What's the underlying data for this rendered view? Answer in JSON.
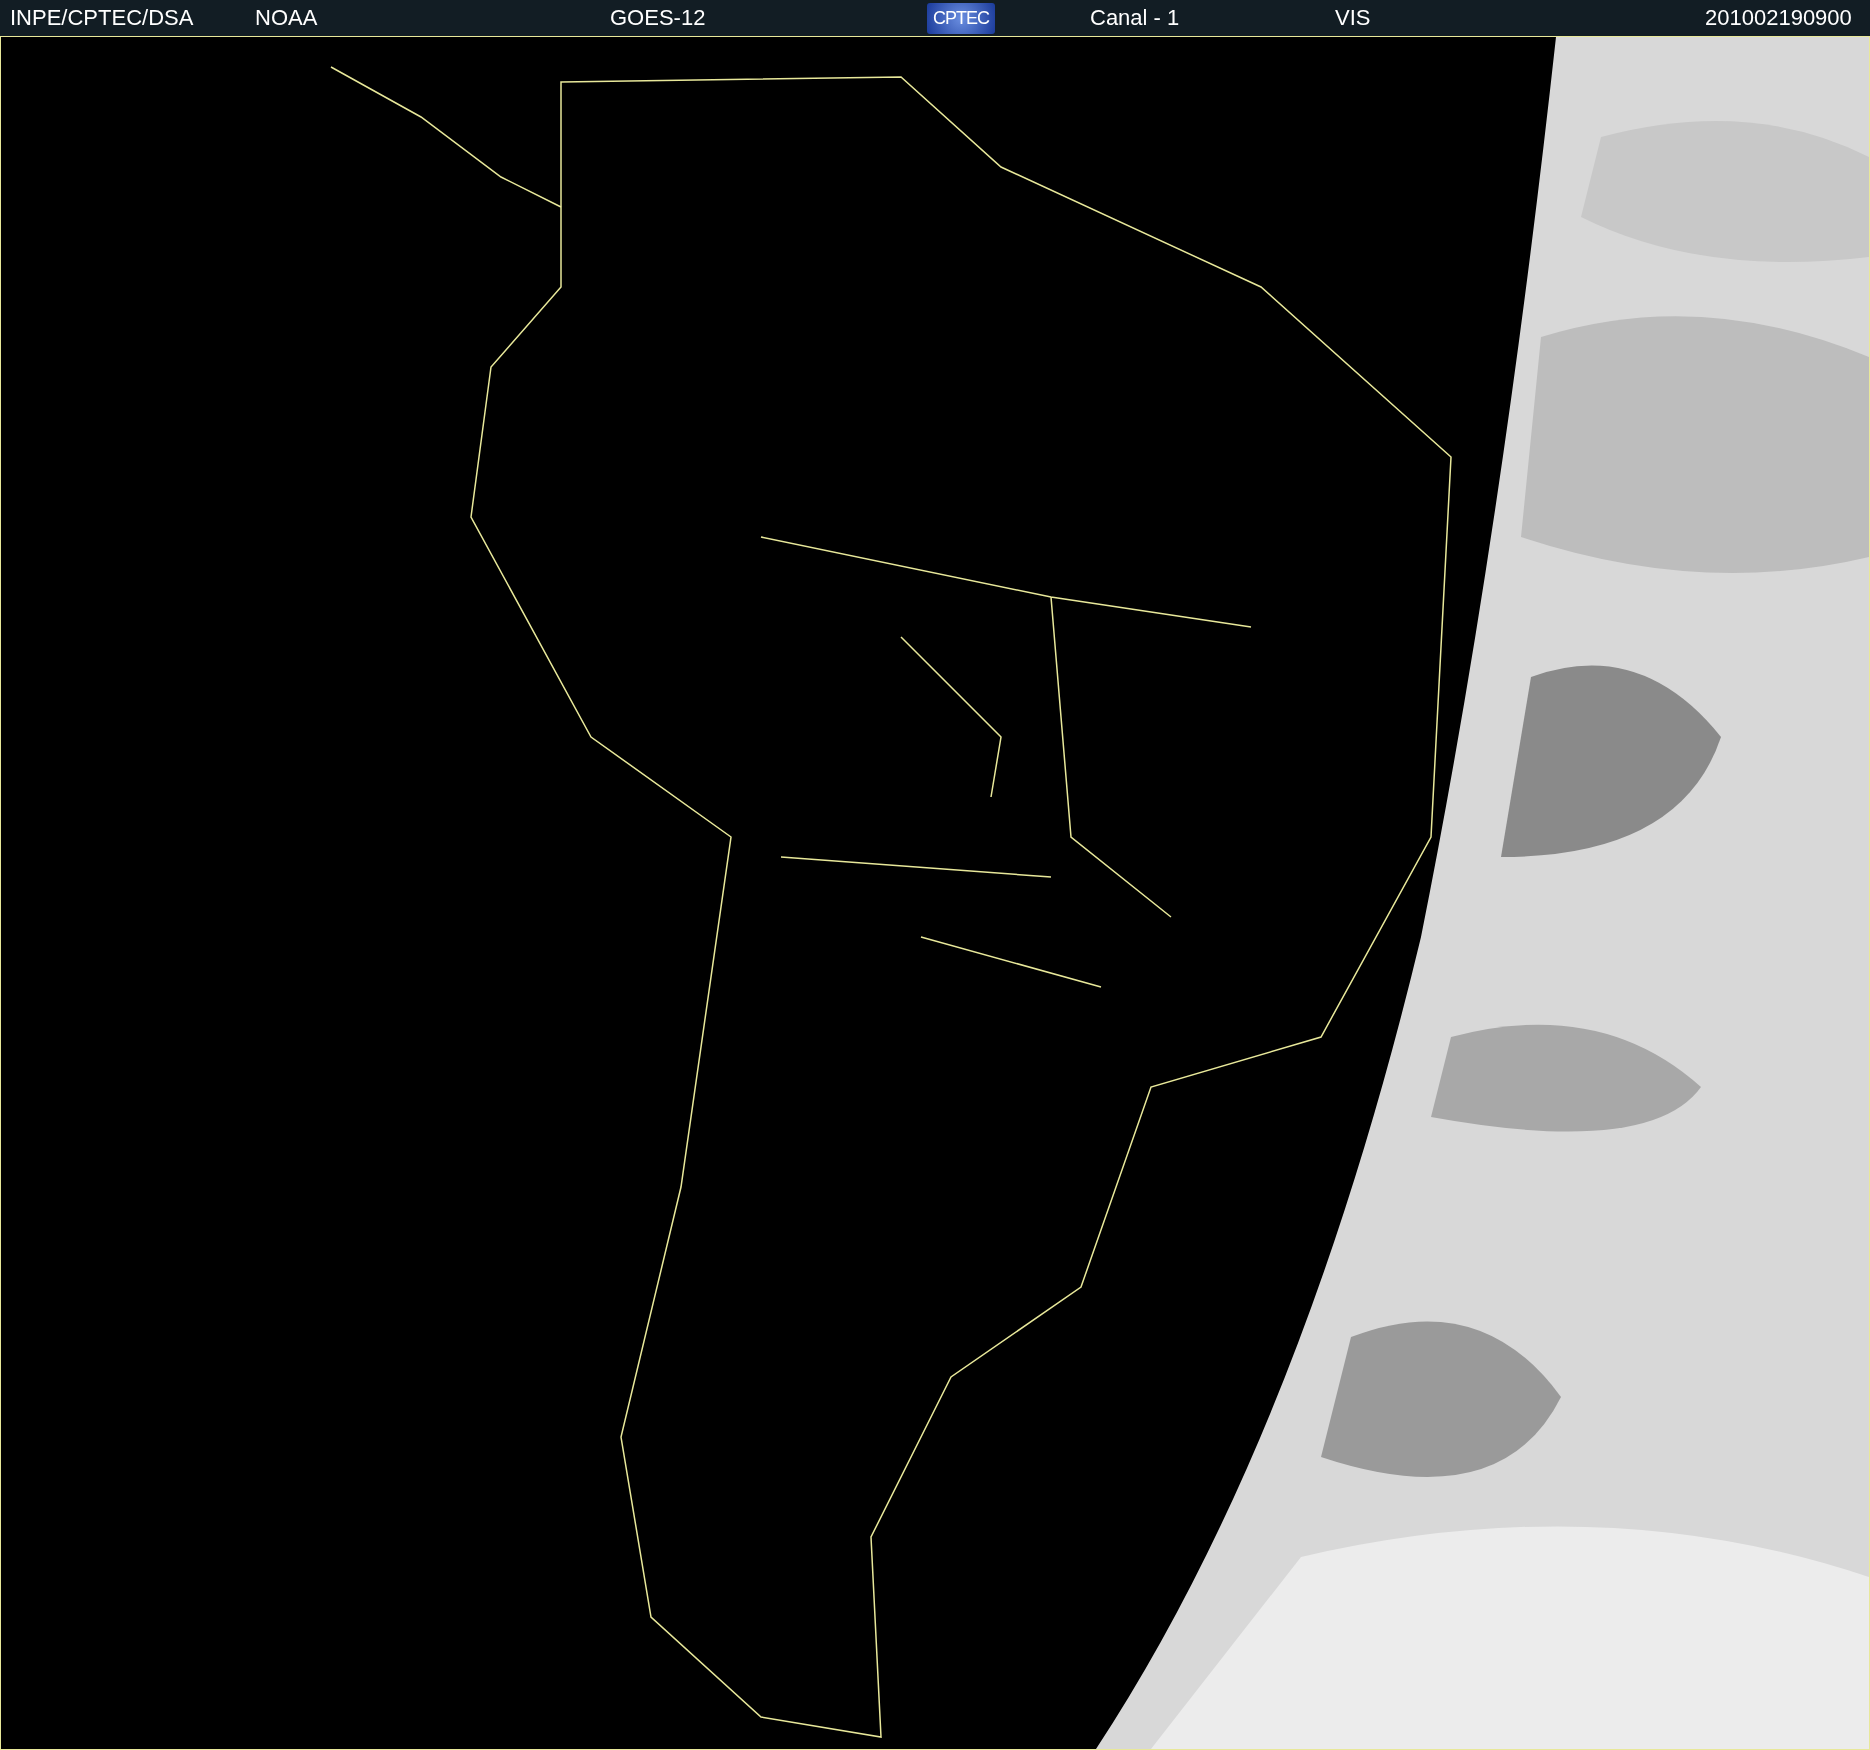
{
  "header": {
    "items": [
      {
        "kind": "text",
        "text": "INPE/CPTEC/DSA"
      },
      {
        "kind": "text",
        "text": "NOAA"
      },
      {
        "kind": "text",
        "text": "GOES-12"
      },
      {
        "kind": "logo",
        "text": "CPTEC"
      },
      {
        "kind": "text",
        "text": "Canal - 1"
      },
      {
        "kind": "text",
        "text": "VIS"
      },
      {
        "kind": "text",
        "text": "201002190900"
      }
    ]
  }
}
